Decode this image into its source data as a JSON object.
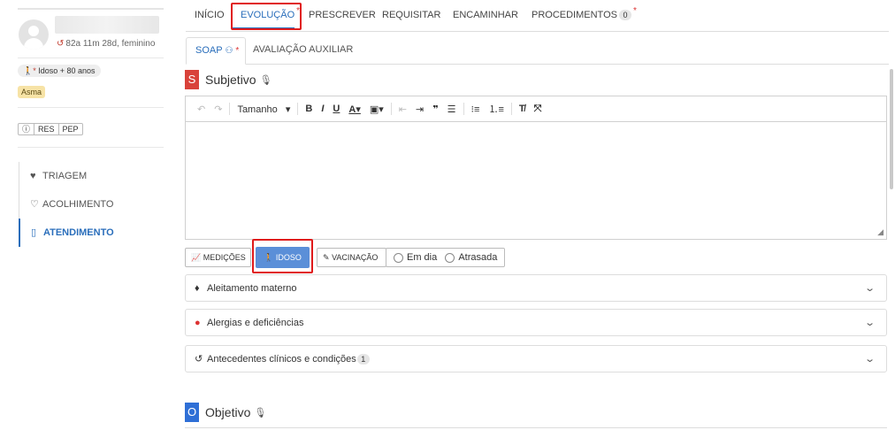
{
  "patient": {
    "age_sex": "82a 11m 28d, feminino",
    "tags": {
      "idoso": "Idoso + 80 anos",
      "asma": "Asma"
    },
    "buttons": [
      "ⓘ",
      "RES",
      "PEP"
    ]
  },
  "sidebar_nav": [
    {
      "label": "TRIAGEM",
      "icon": "heart-pulse-icon"
    },
    {
      "label": "ACOLHIMENTO",
      "icon": "heart-icon"
    },
    {
      "label": "ATENDIMENTO",
      "icon": "clipboard-icon",
      "active": true
    }
  ],
  "top_tabs": {
    "inicio": "INÍCIO",
    "evolucao": "EVOLUÇÃO",
    "prescrever": "PRESCREVER",
    "requisitar": "REQUISITAR",
    "encaminhar": "ENCAMINHAR",
    "procedimentos": "PROCEDIMENTOS",
    "procedimentos_count": "0"
  },
  "sub_tabs": {
    "soap": "SOAP",
    "avaliacao": "AVALIAÇÃO AUXILIAR"
  },
  "subjetivo": {
    "letter": "S",
    "title": "Subjetivo",
    "color": "#d9423a",
    "toolbar_size_label": "Tamanho"
  },
  "action_buttons": {
    "medicoes": "MEDIÇÕES",
    "idoso": "IDOSO",
    "vacinacao": "VACINAÇÃO",
    "em_dia": "Em dia",
    "atrasada": "Atrasada"
  },
  "accordions": [
    {
      "label": "Aleitamento materno",
      "icon": "drop-icon"
    },
    {
      "label": "Alergias e deficiências",
      "icon": "alert-icon"
    },
    {
      "label": "Antecedentes clínicos e condições",
      "icon": "history-icon",
      "count": "1"
    }
  ],
  "objetivo": {
    "letter": "O",
    "title": "Objetivo",
    "color": "#2f6fd6"
  },
  "colors": {
    "accent": "#2a6ebb",
    "highlight_box": "#e01b1b",
    "primary_button": "#5b8fd8"
  }
}
